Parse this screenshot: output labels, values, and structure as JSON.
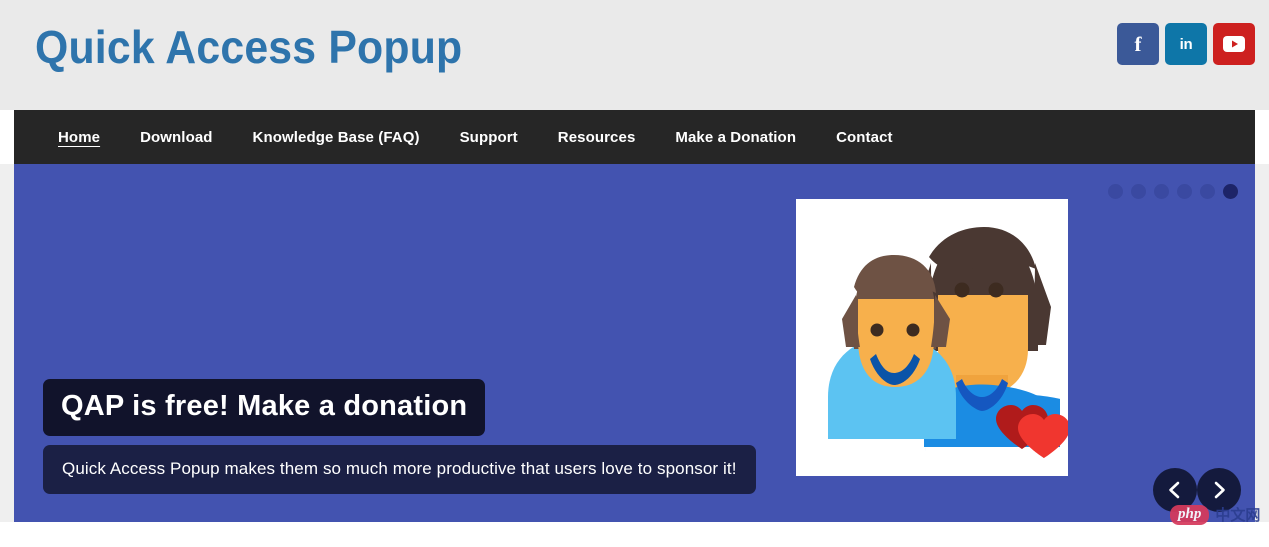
{
  "header": {
    "site_title": "Quick Access Popup",
    "background_color": "#eaeaea",
    "title_color": "#2e74ac",
    "social": [
      {
        "name": "facebook",
        "label": "f",
        "color": "#3b5998"
      },
      {
        "name": "linkedin",
        "label": "in",
        "color": "#0e76a8"
      },
      {
        "name": "youtube",
        "label": "",
        "color": "#cd201f"
      }
    ]
  },
  "nav": {
    "background_color": "#262626",
    "items": [
      {
        "label": "Home",
        "active": true
      },
      {
        "label": "Download",
        "active": false
      },
      {
        "label": "Knowledge Base (FAQ)",
        "active": false
      },
      {
        "label": "Support",
        "active": false
      },
      {
        "label": "Resources",
        "active": false
      },
      {
        "label": "Make a Donation",
        "active": false
      },
      {
        "label": "Contact",
        "active": false
      }
    ]
  },
  "slider": {
    "background_color": "#4353b0",
    "caption_title": "QAP is free! Make a donation",
    "caption_title_bg": "#11132b",
    "caption_subtitle": "Quick Access Popup makes them so much more productive that users love to sponsor it!",
    "caption_subtitle_bg": "#1b2045",
    "dots_total": 6,
    "dot_active_index": 6,
    "prev_label": "Previous slide",
    "next_label": "Next slide",
    "illustration_alt": "Couple illustration with two hearts"
  },
  "watermark": {
    "badge": "php",
    "text": "中文网",
    "badge_color": "#d63a5c",
    "text_color": "#2b3d8f"
  }
}
